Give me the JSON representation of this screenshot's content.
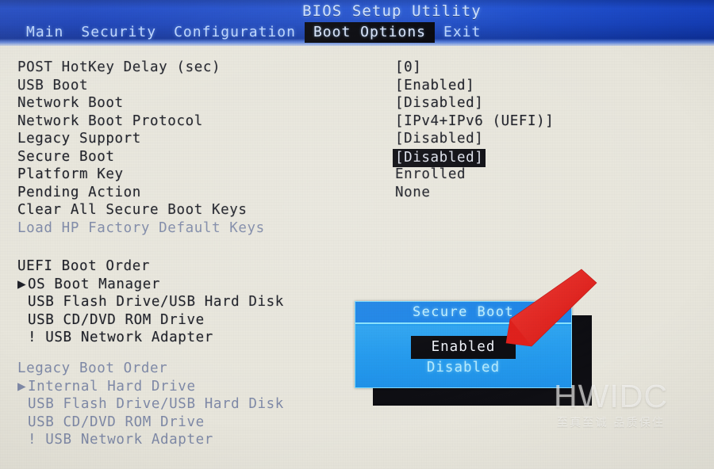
{
  "window": {
    "title": "BIOS Setup Utility"
  },
  "menubar": {
    "items": [
      {
        "label": "Main",
        "selected": false
      },
      {
        "label": "Security",
        "selected": false
      },
      {
        "label": "Configuration",
        "selected": false
      },
      {
        "label": "Boot Options",
        "selected": true
      },
      {
        "label": "Exit",
        "selected": false
      }
    ]
  },
  "settings": [
    {
      "label": "POST HotKey Delay (sec)",
      "value": "[0]",
      "highlighted": false,
      "dimmed": false
    },
    {
      "label": "USB Boot",
      "value": "[Enabled]",
      "highlighted": false,
      "dimmed": false
    },
    {
      "label": "Network Boot",
      "value": "[Disabled]",
      "highlighted": false,
      "dimmed": false
    },
    {
      "label": "Network Boot Protocol",
      "value": "[IPv4+IPv6 (UEFI)]",
      "highlighted": false,
      "dimmed": false
    },
    {
      "label": "Legacy Support",
      "value": "[Disabled]",
      "highlighted": false,
      "dimmed": false
    },
    {
      "label": "Secure Boot",
      "value": "[Disabled]",
      "highlighted": true,
      "dimmed": false
    },
    {
      "label": "Platform Key",
      "value": "Enrolled",
      "highlighted": false,
      "dimmed": false
    },
    {
      "label": "Pending Action",
      "value": "None",
      "highlighted": false,
      "dimmed": false
    },
    {
      "label": "Clear All Secure Boot Keys",
      "value": "",
      "highlighted": false,
      "dimmed": false
    },
    {
      "label": "Load HP Factory Default Keys",
      "value": "",
      "highlighted": false,
      "dimmed": true
    }
  ],
  "uefi_boot_order": {
    "heading": "UEFI Boot Order",
    "dimmed": false,
    "items": [
      {
        "marker": "▶",
        "label": "OS Boot Manager"
      },
      {
        "marker": "",
        "label": "USB Flash Drive/USB Hard Disk"
      },
      {
        "marker": "",
        "label": "USB CD/DVD ROM Drive"
      },
      {
        "marker": "",
        "label": "! USB Network Adapter"
      }
    ]
  },
  "legacy_boot_order": {
    "heading": "Legacy Boot Order",
    "dimmed": true,
    "items": [
      {
        "marker": "▶",
        "label": "Internal Hard Drive"
      },
      {
        "marker": "",
        "label": "USB Flash Drive/USB Hard Disk"
      },
      {
        "marker": "",
        "label": "USB CD/DVD ROM Drive"
      },
      {
        "marker": "",
        "label": "! USB Network Adapter"
      }
    ]
  },
  "popup": {
    "title": "Secure Boot",
    "options": [
      {
        "label": "Enabled",
        "selected": true
      },
      {
        "label": "Disabled",
        "selected": false
      }
    ]
  },
  "annotation": {
    "arrow_color": "#e8201c",
    "arrow_name": "red-pointer-arrow"
  },
  "watermark": {
    "main": "HWIDC",
    "sub": "至真至诚 品质保住"
  },
  "colors": {
    "screen_background": "#e9e7dd",
    "header_blue": "#123fc4",
    "popup_blue": "#1e9cf0",
    "popup_title_blue": "#1a84e8",
    "popup_border_cyan": "#7fdcff",
    "highlight_black": "#07070c",
    "text_dark": "#1a1c24",
    "text_dimmed": "#7f8aa8",
    "accent_cyan": "#b6edff"
  }
}
